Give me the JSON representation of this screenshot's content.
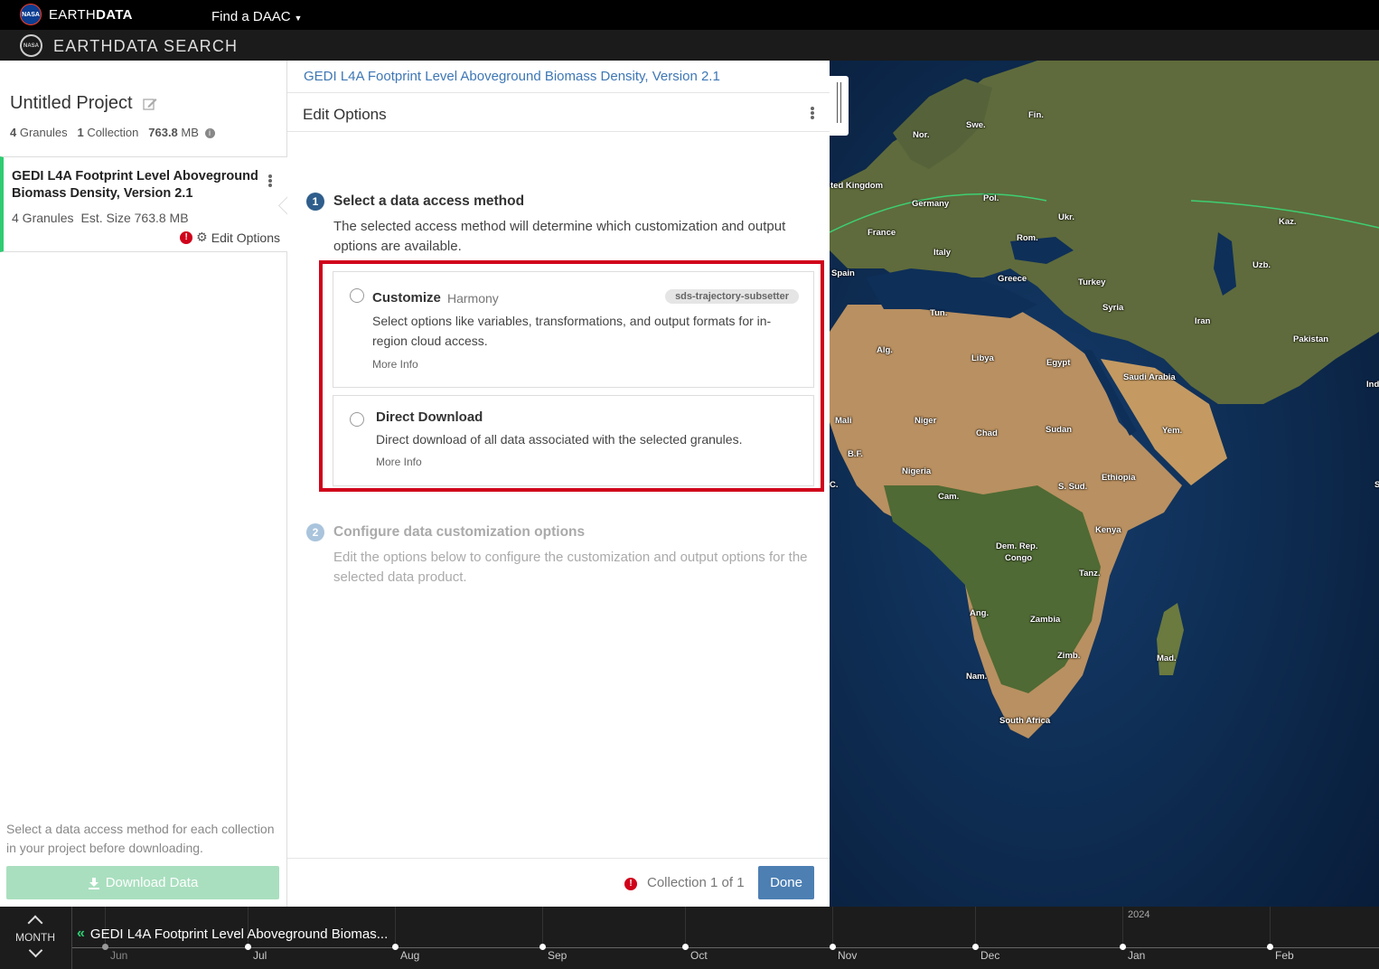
{
  "topbar": {
    "nasa_logo": "NASA",
    "brand_light": "EARTH",
    "brand_bold": "DATA",
    "find_daac": "Find a DAAC"
  },
  "searchbar": {
    "brand_light": "EARTHDATA",
    "brand_bold": "SEARCH"
  },
  "sidebar": {
    "project_title": "Untitled Project",
    "granules_count": "4",
    "granules_label": "Granules",
    "collection_count": "1",
    "collection_label": "Collection",
    "size_value": "763.8",
    "size_unit": "MB",
    "collection": {
      "name": "GEDI L4A Footprint Level Aboveground Biomass Density, Version 2.1",
      "granules": "4 Granules",
      "est_size": "Est. Size 763.8 MB",
      "edit_label": "Edit Options"
    },
    "hint": "Select a data access method for each collection in your project before downloading.",
    "download_label": "Download Data"
  },
  "panel": {
    "collection_link": "GEDI L4A Footprint Level Aboveground Biomass Density, Version 2.1",
    "header_title": "Edit Options",
    "step1": {
      "number": "1",
      "title": "Select a data access method",
      "description": "The selected access method will determine which customization and output options are available."
    },
    "options": [
      {
        "title": "Customize",
        "subtitle": "Harmony",
        "badge": "sds-trajectory-subsetter",
        "description": "Select options like variables, transformations, and output formats for in-region cloud access.",
        "more_info": "More Info"
      },
      {
        "title": "Direct Download",
        "description": "Direct download of all data associated with the selected granules.",
        "more_info": "More Info"
      }
    ],
    "step2": {
      "number": "2",
      "title": "Configure data customization options",
      "description": "Edit the options below to configure the customization and output options for the selected data product."
    },
    "footer": {
      "status": "Collection 1 of 1",
      "done_label": "Done"
    }
  },
  "map": {
    "labels": [
      "Swe.",
      "Fin.",
      "Nor.",
      "ted Kingdom",
      "Germany",
      "Pol.",
      "Ukr.",
      "Kaz.",
      "France",
      "Rom.",
      "Italy",
      "Uzb.",
      "Spain",
      "Greece",
      "Turkey",
      "Tun.",
      "Syria",
      "Iran",
      "Pakistan",
      "Alg.",
      "Libya",
      "Egypt",
      "Saudi Arabia",
      "Ind",
      "Mali",
      "Niger",
      "Chad",
      "Sudan",
      "Yem.",
      "B.F.",
      "Nigeria",
      "Ethiopia",
      "Cam.",
      "S. Sud.",
      "Kenya",
      "Dem. Rep.",
      "Congo",
      "Tanz.",
      "Ang.",
      "Zambia",
      "Zimb.",
      "Mad.",
      "Nam.",
      "South Africa",
      "C.",
      "S"
    ]
  },
  "timeline": {
    "zoom_label": "MONTH",
    "collection_label": "GEDI L4A Footprint Level Aboveground Biomas...",
    "year_label": "2024",
    "months": [
      "Jun",
      "Jul",
      "Aug",
      "Sep",
      "Oct",
      "Nov",
      "Dec",
      "Jan",
      "Feb"
    ]
  },
  "colors": {
    "accent_green": "#2ecc71",
    "error_red": "#d0021b",
    "link_blue": "#3e77b5",
    "button_blue": "#4d7fb3",
    "step_blue": "#2f5e8c"
  }
}
